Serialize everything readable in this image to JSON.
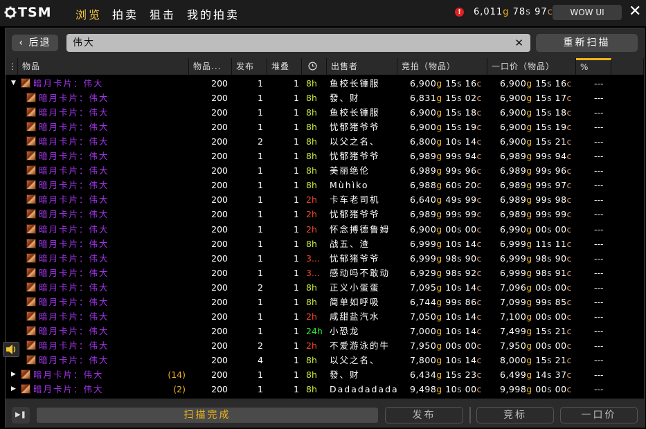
{
  "app": {
    "logo_text": "TSM",
    "icon": "gear-icon"
  },
  "nav": {
    "tabs": [
      "浏览",
      "拍卖",
      "狙击",
      "我的拍卖"
    ],
    "active": 0
  },
  "gold": {
    "g": "6,011",
    "s": "78",
    "c": "97"
  },
  "wow_ui_label": "WOW UI",
  "back_label": "后退",
  "search": {
    "value": "伟大"
  },
  "rescan_label": "重新扫描",
  "columns": [
    "物品",
    "物品...",
    "发布",
    "堆叠",
    "clock-icon",
    "出售者",
    "竞拍（物品）",
    "一口价（物品）",
    "%"
  ],
  "rows": [
    {
      "name": "暗月卡片：伟大",
      "ilvl": "200",
      "posts": "1",
      "stack": "1",
      "time": "8h",
      "seller": "鱼校长锤服",
      "bid": [
        "6,900",
        "15",
        "16"
      ],
      "buyout": [
        "6,900",
        "15",
        "16"
      ],
      "pct": "---",
      "expand": "open"
    },
    {
      "name": "暗月卡片：伟大",
      "ilvl": "200",
      "posts": "1",
      "stack": "1",
      "time": "8h",
      "seller": "發、财",
      "bid": [
        "6,831",
        "15",
        "02"
      ],
      "buyout": [
        "6,900",
        "15",
        "17"
      ],
      "pct": "---"
    },
    {
      "name": "暗月卡片：伟大",
      "ilvl": "200",
      "posts": "1",
      "stack": "1",
      "time": "8h",
      "seller": "鱼校长锤服",
      "bid": [
        "6,900",
        "15",
        "18"
      ],
      "buyout": [
        "6,900",
        "15",
        "18"
      ],
      "pct": "---"
    },
    {
      "name": "暗月卡片：伟大",
      "ilvl": "200",
      "posts": "1",
      "stack": "1",
      "time": "8h",
      "seller": "忧郁猪爷爷",
      "bid": [
        "6,900",
        "15",
        "19"
      ],
      "buyout": [
        "6,900",
        "15",
        "19"
      ],
      "pct": "---"
    },
    {
      "name": "暗月卡片：伟大",
      "ilvl": "200",
      "posts": "2",
      "stack": "1",
      "time": "8h",
      "seller": "以父之名、",
      "bid": [
        "6,800",
        "10",
        "14"
      ],
      "buyout": [
        "6,900",
        "15",
        "21"
      ],
      "pct": "---"
    },
    {
      "name": "暗月卡片：伟大",
      "ilvl": "200",
      "posts": "1",
      "stack": "1",
      "time": "8h",
      "seller": "忧郁猪爷爷",
      "bid": [
        "6,989",
        "99",
        "94"
      ],
      "buyout": [
        "6,989",
        "99",
        "94"
      ],
      "pct": "---"
    },
    {
      "name": "暗月卡片：伟大",
      "ilvl": "200",
      "posts": "1",
      "stack": "1",
      "time": "8h",
      "seller": "美丽绝伦",
      "bid": [
        "6,989",
        "99",
        "96"
      ],
      "buyout": [
        "6,989",
        "99",
        "96"
      ],
      "pct": "---"
    },
    {
      "name": "暗月卡片：伟大",
      "ilvl": "200",
      "posts": "1",
      "stack": "1",
      "time": "8h",
      "seller": "Mùhìko",
      "bid": [
        "6,988",
        "60",
        "20"
      ],
      "buyout": [
        "6,989",
        "99",
        "97"
      ],
      "pct": "---"
    },
    {
      "name": "暗月卡片：伟大",
      "ilvl": "200",
      "posts": "1",
      "stack": "1",
      "time": "2h",
      "seller": "卡车老司机",
      "bid": [
        "6,640",
        "49",
        "99"
      ],
      "buyout": [
        "6,989",
        "99",
        "98"
      ],
      "pct": "---"
    },
    {
      "name": "暗月卡片：伟大",
      "ilvl": "200",
      "posts": "1",
      "stack": "1",
      "time": "2h",
      "seller": "忧郁猪爷爷",
      "bid": [
        "6,989",
        "99",
        "99"
      ],
      "buyout": [
        "6,989",
        "99",
        "99"
      ],
      "pct": "---"
    },
    {
      "name": "暗月卡片：伟大",
      "ilvl": "200",
      "posts": "1",
      "stack": "1",
      "time": "2h",
      "seller": "怀念搏德鲁姆",
      "bid": [
        "6,900",
        "00",
        "00"
      ],
      "buyout": [
        "6,990",
        "00",
        "00"
      ],
      "pct": "---"
    },
    {
      "name": "暗月卡片：伟大",
      "ilvl": "200",
      "posts": "1",
      "stack": "1",
      "time": "8h",
      "seller": "战五、渣",
      "bid": [
        "6,999",
        "10",
        "14"
      ],
      "buyout": [
        "6,999",
        "11",
        "11"
      ],
      "pct": "---"
    },
    {
      "name": "暗月卡片：伟大",
      "ilvl": "200",
      "posts": "1",
      "stack": "1",
      "time": "3...",
      "seller": "忧郁猪爷爷",
      "bid": [
        "6,999",
        "98",
        "90"
      ],
      "buyout": [
        "6,999",
        "98",
        "90"
      ],
      "pct": "---"
    },
    {
      "name": "暗月卡片：伟大",
      "ilvl": "200",
      "posts": "1",
      "stack": "1",
      "time": "3...",
      "seller": "感动吗不敢动",
      "bid": [
        "6,929",
        "98",
        "92"
      ],
      "buyout": [
        "6,999",
        "98",
        "91"
      ],
      "pct": "---"
    },
    {
      "name": "暗月卡片：伟大",
      "ilvl": "200",
      "posts": "2",
      "stack": "1",
      "time": "8h",
      "seller": "正义小蛋蛋",
      "bid": [
        "7,095",
        "10",
        "14"
      ],
      "buyout": [
        "7,096",
        "00",
        "00"
      ],
      "pct": "---"
    },
    {
      "name": "暗月卡片：伟大",
      "ilvl": "200",
      "posts": "1",
      "stack": "1",
      "time": "8h",
      "seller": "简单如呼吸",
      "bid": [
        "6,744",
        "99",
        "86"
      ],
      "buyout": [
        "7,099",
        "99",
        "85"
      ],
      "pct": "---"
    },
    {
      "name": "暗月卡片：伟大",
      "ilvl": "200",
      "posts": "1",
      "stack": "1",
      "time": "2h",
      "seller": "咸甜盐汽水",
      "bid": [
        "7,050",
        "10",
        "14"
      ],
      "buyout": [
        "7,100",
        "00",
        "00"
      ],
      "pct": "---"
    },
    {
      "name": "暗月卡片：伟大",
      "ilvl": "200",
      "posts": "1",
      "stack": "1",
      "time": "24h",
      "seller": "小恐龙",
      "bid": [
        "7,000",
        "10",
        "14"
      ],
      "buyout": [
        "7,499",
        "15",
        "21"
      ],
      "pct": "---"
    },
    {
      "name": "暗月卡片：伟大",
      "ilvl": "200",
      "posts": "2",
      "stack": "1",
      "time": "2h",
      "seller": "不爱游泳的牛",
      "bid": [
        "7,950",
        "00",
        "00"
      ],
      "buyout": [
        "7,950",
        "00",
        "00"
      ],
      "pct": "---"
    },
    {
      "name": "暗月卡片：伟大",
      "ilvl": "200",
      "posts": "4",
      "stack": "1",
      "time": "8h",
      "seller": "以父之名、",
      "bid": [
        "7,800",
        "10",
        "14"
      ],
      "buyout": [
        "8,000",
        "15",
        "21"
      ],
      "pct": "---"
    },
    {
      "name": "暗月卡片：伟大",
      "ilvl": "200",
      "posts": "1",
      "stack": "1",
      "time": "8h",
      "seller": "發、财",
      "bid": [
        "6,434",
        "15",
        "23"
      ],
      "buyout": [
        "6,499",
        "14",
        "37"
      ],
      "pct": "---",
      "expand": "closed",
      "count": "(14)"
    },
    {
      "name": "暗月卡片：伟大",
      "ilvl": "200",
      "posts": "1",
      "stack": "1",
      "time": "8h",
      "seller": "Dadadadada",
      "bid": [
        "9,498",
        "10",
        "00"
      ],
      "buyout": [
        "9,998",
        "00",
        "00"
      ],
      "pct": "---",
      "expand": "closed",
      "count": "(2)"
    }
  ],
  "footer": {
    "status": "扫描完成",
    "post": "发布",
    "bid": "竞标",
    "buyout": "一口价"
  }
}
